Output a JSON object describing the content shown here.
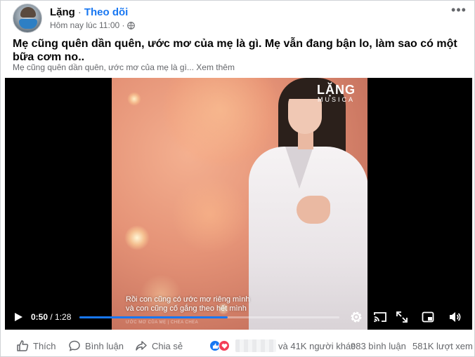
{
  "post": {
    "author": "Lặng",
    "separator": "·",
    "follow_label": "Theo dõi",
    "timestamp": "Hôm nay lúc 11:00 ·",
    "more_label": "•••",
    "text": "Mẹ cũng quên dần quên, ước mơ của mẹ là gì. Mẹ vẫn đang bận lo, làm sao có một bữa cơm no..",
    "preview": "Mẹ cũng quên dần quên, ước mơ của mẹ là gì...",
    "see_more": "Xem thêm"
  },
  "video": {
    "watermark_main": "LẶNG",
    "watermark_sub": "MUSICA",
    "caption_line1": "Rồi con cũng có ước mơ riêng mình",
    "caption_line2": "và con cũng cố gắng theo hết mình",
    "caption_credit": "ƯỚC MƠ CỦA MẸ | CHEA CHEA",
    "current_time": "0:50",
    "time_sep": " / ",
    "duration": "1:28",
    "progress_fraction": 0.57,
    "accent_color": "#1877f2"
  },
  "footer": {
    "like_label": "Thích",
    "comment_label": "Bình luận",
    "share_label": "Chia sẻ",
    "reactions_text": "và 41K người khác",
    "comments_count": "983 bình luận",
    "views_count": "581K lượt xem"
  },
  "icons": [
    "globe-icon",
    "more-icon",
    "play-icon",
    "settings-icon",
    "cast-icon",
    "fullscreen-icon",
    "miniplayer-icon",
    "volume-icon",
    "like-icon",
    "comment-icon",
    "share-icon",
    "like-reaction-icon",
    "love-reaction-icon"
  ]
}
